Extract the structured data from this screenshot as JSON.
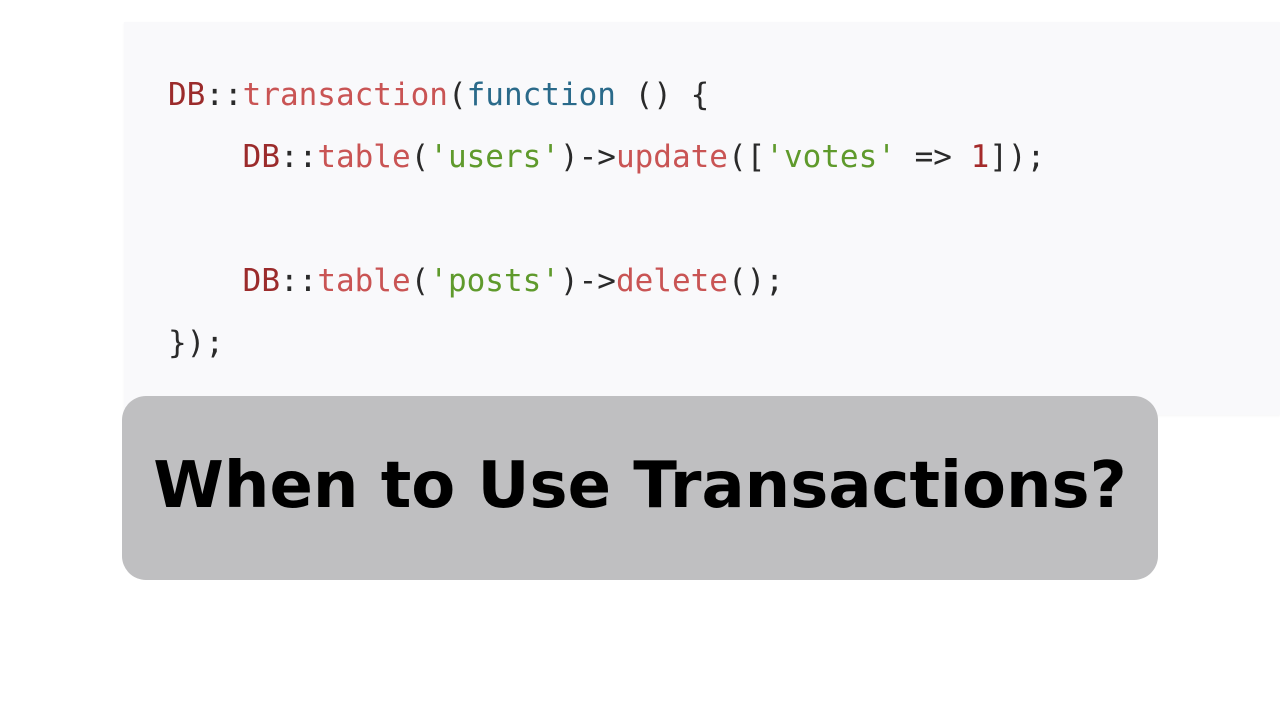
{
  "code_block": {
    "language": "php",
    "lines": [
      [
        {
          "t": "DB",
          "k": "class"
        },
        {
          "t": "::",
          "k": "punct"
        },
        {
          "t": "transaction",
          "k": "method"
        },
        {
          "t": "(",
          "k": "punct"
        },
        {
          "t": "function",
          "k": "kw"
        },
        {
          "t": " () {",
          "k": "punct"
        }
      ],
      [
        {
          "t": "    ",
          "k": "punct"
        },
        {
          "t": "DB",
          "k": "class"
        },
        {
          "t": "::",
          "k": "punct"
        },
        {
          "t": "table",
          "k": "method"
        },
        {
          "t": "(",
          "k": "punct"
        },
        {
          "t": "'users'",
          "k": "str"
        },
        {
          "t": ")->",
          "k": "punct"
        },
        {
          "t": "update",
          "k": "method"
        },
        {
          "t": "([",
          "k": "punct"
        },
        {
          "t": "'votes'",
          "k": "str"
        },
        {
          "t": " => ",
          "k": "punct"
        },
        {
          "t": "1",
          "k": "num"
        },
        {
          "t": "]);",
          "k": "punct"
        }
      ],
      [],
      [
        {
          "t": "    ",
          "k": "punct"
        },
        {
          "t": "DB",
          "k": "class"
        },
        {
          "t": "::",
          "k": "punct"
        },
        {
          "t": "table",
          "k": "method"
        },
        {
          "t": "(",
          "k": "punct"
        },
        {
          "t": "'posts'",
          "k": "str"
        },
        {
          "t": ")->",
          "k": "punct"
        },
        {
          "t": "delete",
          "k": "method"
        },
        {
          "t": "();",
          "k": "punct"
        }
      ],
      [
        {
          "t": "});",
          "k": "punct"
        }
      ]
    ]
  },
  "banner": {
    "title": "When to Use Transactions?"
  },
  "colors": {
    "code_background": "#f9f9fb",
    "banner_background": "#bfbfc1",
    "class": "#9b2b2b",
    "method": "#c95454",
    "keyword": "#2a6a8a",
    "string": "#5f9a2c",
    "number": "#a42a2a"
  }
}
